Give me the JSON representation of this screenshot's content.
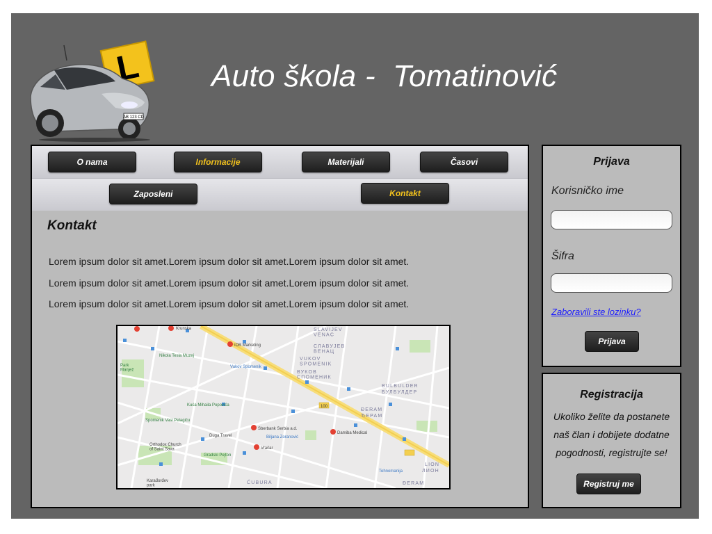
{
  "header": {
    "title": "Auto škola -  Tomatinović",
    "logo_plate_text": "AB 123 CD",
    "logo_sign_letter": "L"
  },
  "nav": {
    "row1": [
      {
        "label": "O nama",
        "active": false
      },
      {
        "label": "Informacije",
        "active": true
      },
      {
        "label": "Materijali",
        "active": false
      },
      {
        "label": "Časovi",
        "active": false
      }
    ],
    "row2": [
      {
        "label": "Zaposleni",
        "active": false
      },
      {
        "label": "Kontakt",
        "active": true
      }
    ],
    "active_color": "#f3c21c"
  },
  "content": {
    "heading": "Kontakt",
    "paragraphs": [
      "Lorem ipsum dolor sit amet.Lorem ipsum dolor sit amet.Lorem ipsum dolor sit amet.",
      "Lorem ipsum dolor sit amet.Lorem ipsum dolor sit amet.Lorem ipsum dolor sit amet.",
      "Lorem ipsum dolor sit amet.Lorem ipsum dolor sit amet.Lorem ipsum dolor sit amet."
    ],
    "map_labels": {
      "krunska": "Krunska",
      "idb": "IDB Marketing",
      "tesla": "Nikola Tesla Muzej",
      "vukov": "Vukov Spomenik",
      "park": "Park\nManjež",
      "slavija": "SLAVIJEV\nVENAC",
      "slavija_cyr": "СЛАВУЈЕВ\nВЕНАЦ",
      "vukov_big": "VUKOV\nSPOMENIK",
      "vukov_cyr": "ВУКОВ\nСПОМЕНИК",
      "bulbulder": "BULBULDER",
      "bulbulder_cyr": "БУЛБУЛДЕР",
      "kuca": "Kuća Mihaila Popovića",
      "djeram": "ĐERAM",
      "djeram_cyr": "ЂЕРАМ",
      "spomenik": "Spomenik Vasi Pelagiću",
      "sberbank": "Sberbank Serbia a.d.",
      "dugatravel": "Duga Travel",
      "biljana": "Biljana Zoranović",
      "damiba": "Damiba Medical",
      "orthodox": "Orthodox Church\nof Saint Sava",
      "vracar": "Vračar",
      "gradski": "Gradski Pejton",
      "tehnomanija": "Tehnomanija",
      "lion": "LION",
      "lion_cyr": "ЛИОН",
      "cubura": "ĆUBURA",
      "karadjordjev": "Karađorđev\npark",
      "djeram2": "ĐERAM",
      "road_num": "100"
    }
  },
  "login": {
    "title": "Prijava",
    "username_label": "Korisničko ime",
    "username_value": "",
    "password_label": "Šifra",
    "password_value": "",
    "forgot_link": "Zaboravili ste lozinku?",
    "submit_label": "Prijava"
  },
  "register": {
    "title": "Registracija",
    "text": "Ukoliko želite da postanete naš član i dobijete dodatne pogodnosti, registrujte se!",
    "button_label": "Registruj me"
  },
  "colors": {
    "frame_bg": "#646464",
    "panel_bg": "#bbbbbb",
    "button_bg": "#2c2c2c",
    "link": "#1a1aff"
  }
}
